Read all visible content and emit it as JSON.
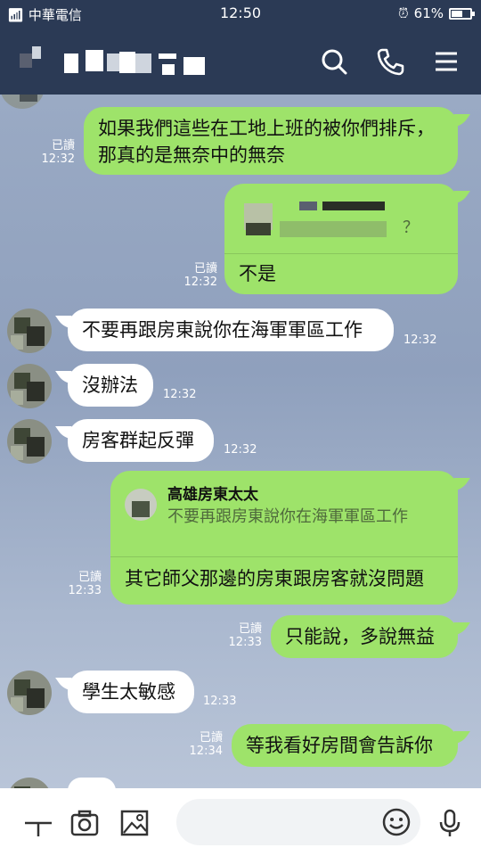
{
  "status_bar": {
    "carrier": "中華電信",
    "time": "12:50",
    "battery": "61%",
    "battery_level": 0.61
  },
  "header": {
    "icons": [
      "search-icon",
      "phone-icon",
      "menu-icon"
    ]
  },
  "messages": [
    {
      "side": "me",
      "text": "如果我們這些在工地上班的被你們排斥，那真的是無奈中的無奈",
      "read": "已讀",
      "time": "12:32"
    },
    {
      "side": "me",
      "text": "不是",
      "quote_text": "？",
      "read": "已讀",
      "time": "12:32"
    },
    {
      "side": "them",
      "text": "不要再跟房東說你在海軍軍區工作",
      "time": "12:32"
    },
    {
      "side": "them",
      "text": "沒辦法",
      "time": "12:32"
    },
    {
      "side": "them",
      "text": "房客群起反彈",
      "time": "12:32"
    },
    {
      "side": "me",
      "quote_name": "高雄房東太太",
      "quote_text": "不要再跟房東說你在海軍軍區工作",
      "text": "其它師父那邊的房東跟房客就沒問題",
      "read": "已讀",
      "time": "12:33"
    },
    {
      "side": "me",
      "text": "只能說，多說無益",
      "read": "已讀",
      "time": "12:33"
    },
    {
      "side": "them",
      "text": "學生太敏感",
      "time": "12:33"
    },
    {
      "side": "me",
      "text": "等我看好房間會告訴你",
      "read": "已讀",
      "time": "12:34"
    }
  ],
  "bottom_bar": {
    "icons": [
      "plus-icon",
      "camera-icon",
      "image-icon",
      "emoji-icon",
      "mic-icon"
    ],
    "input_placeholder": ""
  }
}
